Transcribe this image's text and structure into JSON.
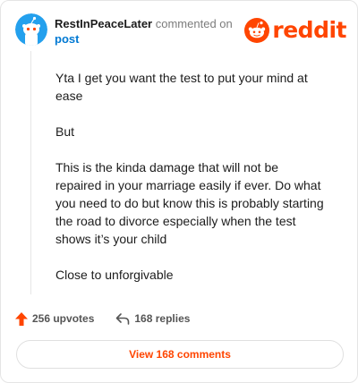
{
  "comment": {
    "username": "RestInPeaceLater",
    "action_text": "commented on",
    "target_link": "post",
    "paragraphs": [
      "Yta I get you want the test to put your mind at ease",
      "But",
      "This is the kinda damage that will not be repaired in your marriage easily if ever. Do what you need to do but know this is probably starting the road to divorce especially when the test shows it’s your child",
      "Close to unforgivable"
    ]
  },
  "brand": {
    "name": "reddit",
    "color": "#ff4500",
    "icon": "reddit-snoo-logo"
  },
  "stats": {
    "upvotes": "256 upvotes",
    "replies": "168 replies",
    "upvote_icon": "upvote-arrow-icon",
    "reply_icon": "reply-arrow-icon"
  },
  "footer": {
    "view_comments_label": "View 168 comments"
  },
  "colors": {
    "accent": "#ff4500",
    "link": "#0079d3",
    "avatar_bg": "#24a0ed"
  }
}
